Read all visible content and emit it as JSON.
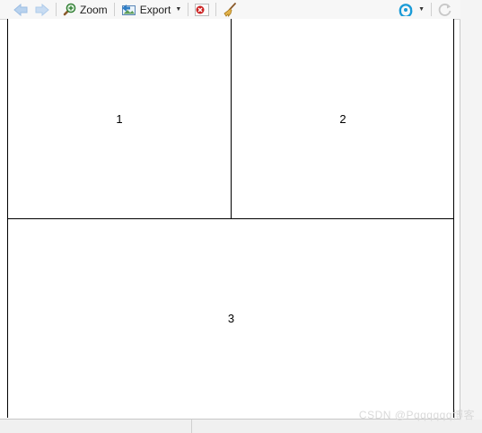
{
  "toolbar": {
    "zoom_label": "Zoom",
    "export_label": "Export"
  },
  "plot": {
    "panels": [
      {
        "label": "1"
      },
      {
        "label": "2"
      },
      {
        "label": "3"
      }
    ]
  },
  "watermark": "CSDN @Pqqqqqq博客",
  "icons": {
    "back": "arrow-left-icon",
    "forward": "arrow-right-icon",
    "zoom": "magnifier-icon",
    "export": "export-image-icon",
    "remove": "remove-plot-icon",
    "clear": "broom-icon",
    "publish": "publish-icon",
    "refresh": "refresh-icon"
  },
  "colors": {
    "arrow_disabled": "#a9c7e8",
    "remove_red": "#cc2222",
    "publish_blue": "#1a9bd7"
  }
}
